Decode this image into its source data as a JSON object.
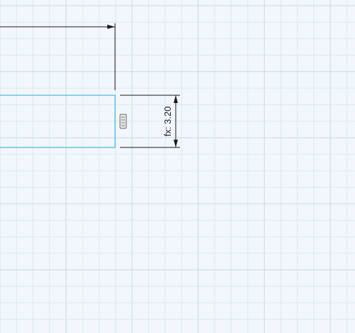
{
  "sketch": {
    "vertical_dimension_label": "fx: 3.20",
    "constraint_glyph": "vertical-constraint-icon",
    "colors": {
      "background": "#f1f7fc",
      "grid_minor": "#dde8f0",
      "grid_major": "#c9d9e6",
      "sketch_line": "#6cc0e6",
      "dimension_line": "#1a1a1a"
    }
  }
}
